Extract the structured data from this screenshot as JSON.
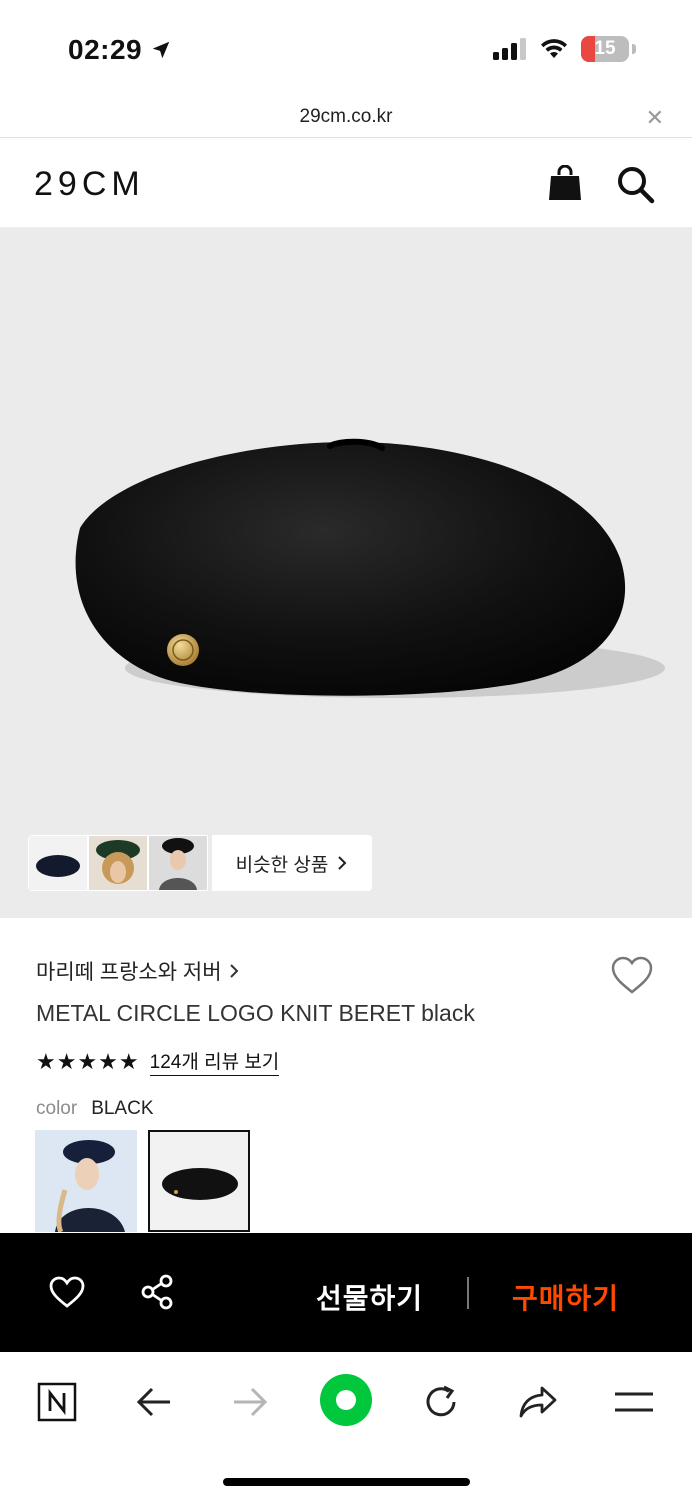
{
  "status": {
    "time": "02:29",
    "battery": "15"
  },
  "browser": {
    "url": "29cm.co.kr"
  },
  "site": {
    "logo": "29CM"
  },
  "hero": {
    "similar_label": "비슷한 상품"
  },
  "product": {
    "brand": "마리떼 프랑소와 저버",
    "name": "METAL CIRCLE LOGO KNIT BERET black",
    "stars": "★★★★★",
    "rating_stars": 5,
    "review_link": "124개 리뷰 보기",
    "color_label": "color",
    "color_value": "BLACK"
  },
  "actions": {
    "gift": "선물하기",
    "buy": "구매하기"
  },
  "colors": {
    "accent": "#ff4800",
    "green": "#00c73c",
    "hero_bg": "#ebebeb"
  }
}
